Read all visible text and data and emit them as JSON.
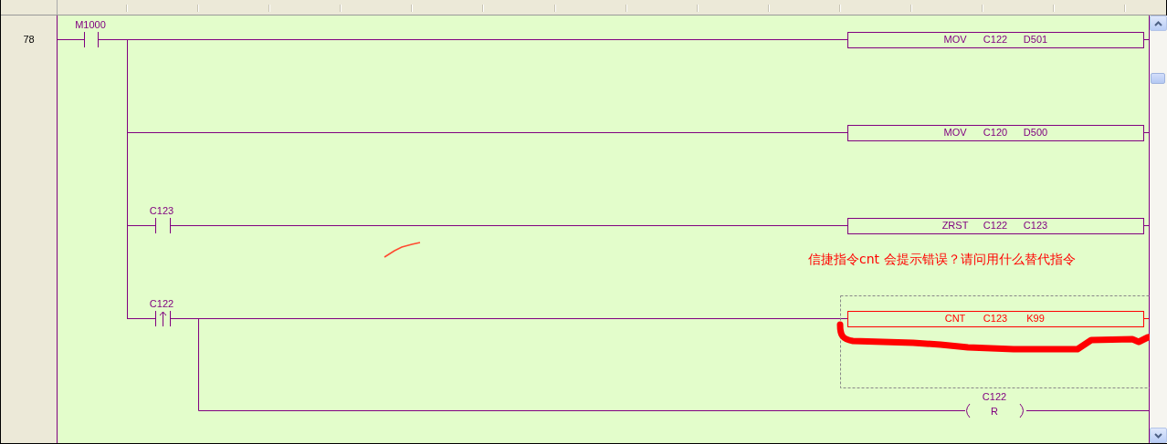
{
  "rung_number": "78",
  "input_contact": {
    "label": "M1000",
    "kind": "normally_open"
  },
  "branches": [
    {
      "instruction": {
        "mnemonic": "MOV",
        "operand_1": "C122",
        "operand_2": "D501",
        "selected": false,
        "error": false
      }
    },
    {
      "instruction": {
        "mnemonic": "MOV",
        "operand_1": "C120",
        "operand_2": "D500",
        "selected": false,
        "error": false
      }
    },
    {
      "contact": {
        "label": "C123",
        "kind": "normally_open"
      },
      "instruction": {
        "mnemonic": "ZRST",
        "operand_1": "C122",
        "operand_2": "C123",
        "selected": false,
        "error": false
      }
    },
    {
      "contact": {
        "label": "C122",
        "kind": "rising_edge"
      },
      "instruction": {
        "mnemonic": "CNT",
        "operand_1": "C123",
        "operand_2": "K99",
        "selected": true,
        "error": true
      }
    }
  ],
  "coil": {
    "device": "C122",
    "function": "R"
  },
  "annotation": "信捷指令cnt 会提示错误？请问用什么替代指令"
}
